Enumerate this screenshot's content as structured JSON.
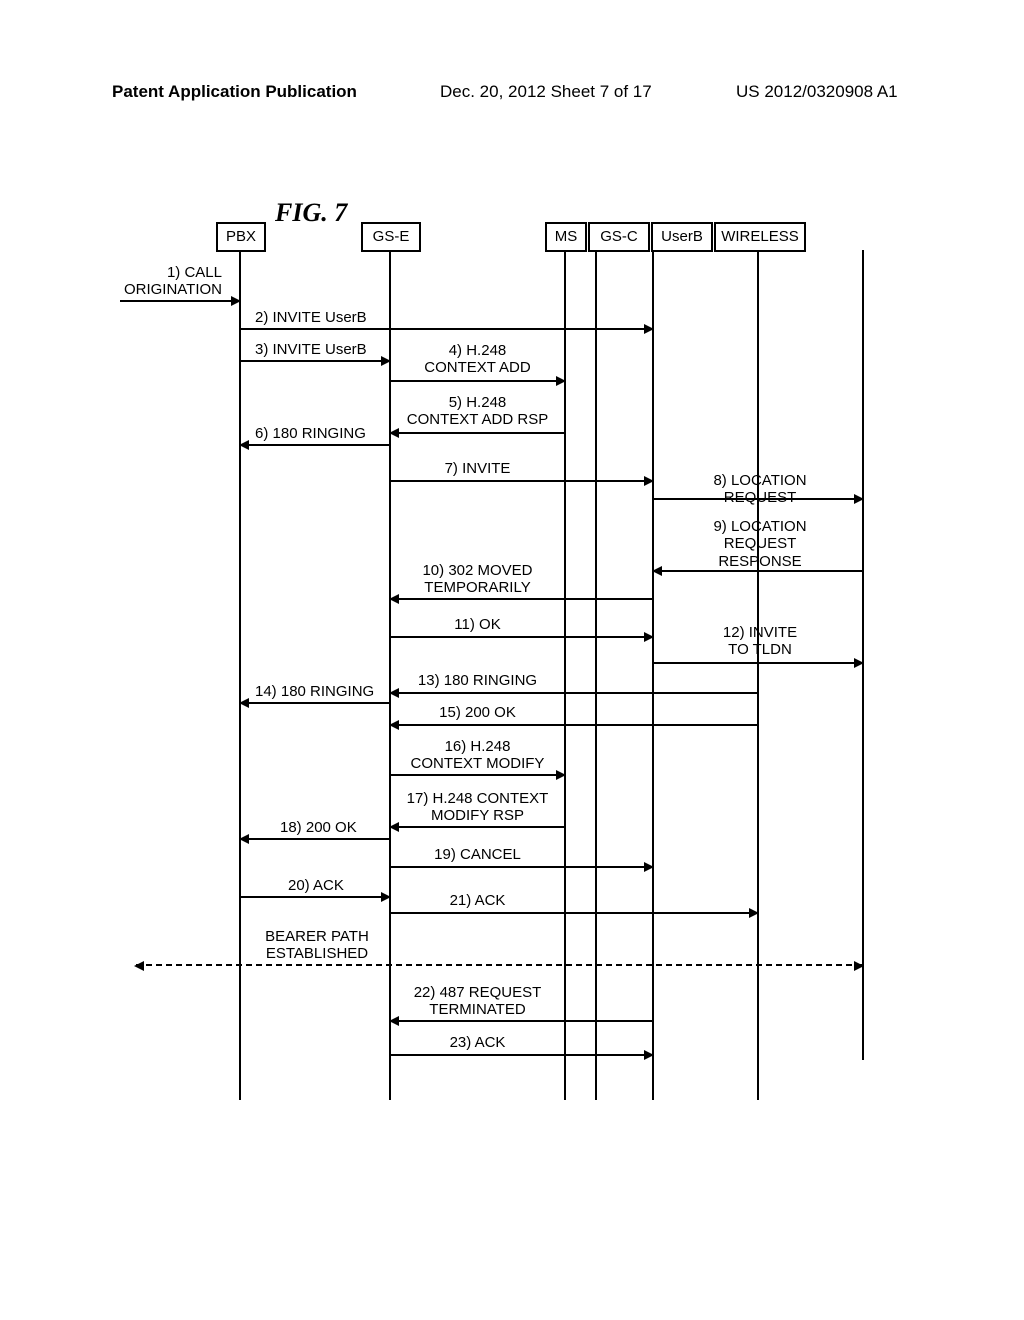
{
  "header": {
    "left": "Patent Application Publication",
    "mid": "Dec. 20, 2012  Sheet 7 of 17",
    "right": "US 2012/0320908 A1"
  },
  "figure_title": "FIG. 7",
  "actors": {
    "pbx": "PBX",
    "gse": "GS-E",
    "ms": "MS",
    "gsc": "GS-C",
    "userb": "UserB",
    "wireless": "WIRELESS"
  },
  "msgs": {
    "m1": "1) CALL\nORIGINATION",
    "m2": "2) INVITE UserB",
    "m3": "3) INVITE UserB",
    "m4": "4) H.248\nCONTEXT ADD",
    "m5": "5) H.248\nCONTEXT ADD RSP",
    "m6": "6) 180 RINGING",
    "m7": "7) INVITE",
    "m8": "8) LOCATION\nREQUEST",
    "m9": "9) LOCATION\nREQUEST\nRESPONSE",
    "m10": "10) 302 MOVED\nTEMPORARILY",
    "m11": "11) OK",
    "m12": "12) INVITE\nTO TLDN",
    "m13": "13) 180 RINGING",
    "m14": "14) 180 RINGING",
    "m15": "15) 200 OK",
    "m16": "16) H.248\nCONTEXT MODIFY",
    "m17": "17) H.248 CONTEXT\nMODIFY RSP",
    "m18": "18) 200 OK",
    "m19": "19) CANCEL",
    "m20": "20) ACK",
    "m21": "21) ACK",
    "bp": "BEARER PATH\nESTABLISHED",
    "m22": "22) 487 REQUEST\nTERMINATED",
    "m23": "23) ACK"
  }
}
